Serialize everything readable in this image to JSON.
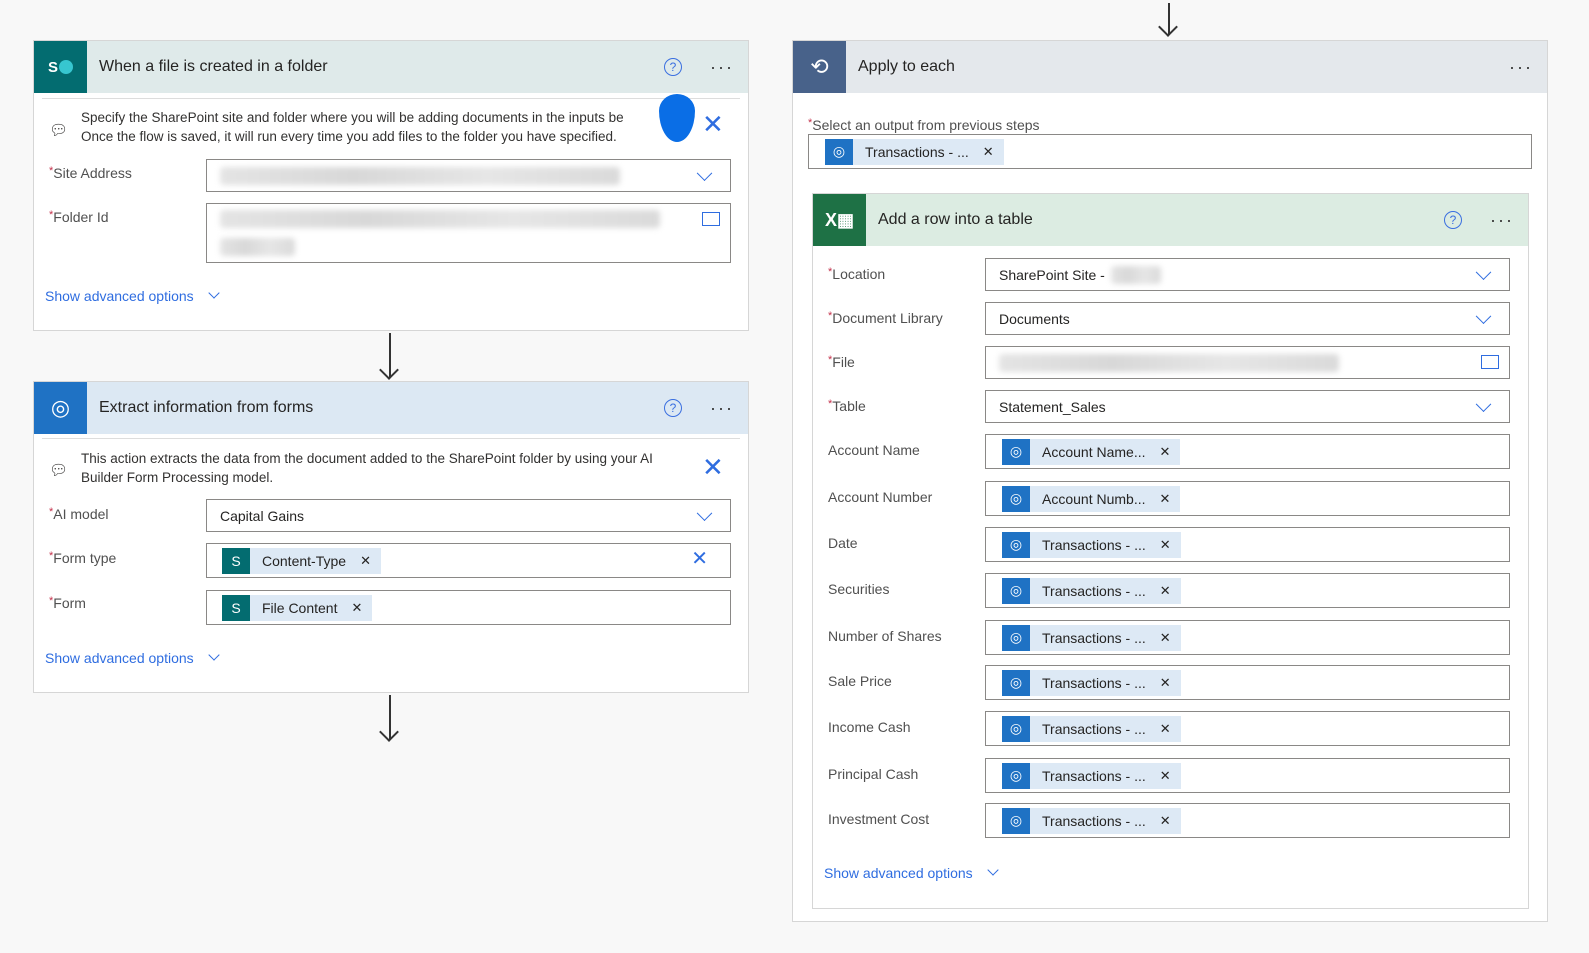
{
  "trigger": {
    "title": "When a file is created in a folder",
    "info": "Specify the SharePoint site and folder where you will be adding documents in the inputs below. Once the flow is saved, it will run every time you add files to the folder you have specified.",
    "info_line1": "Specify the SharePoint site and folder where you will be adding documents in the inputs be",
    "info_line2": "Once the flow is saved, it will run every time you add files to the folder you have specified.",
    "fields": [
      {
        "label": "Site Address"
      },
      {
        "label": "Folder Id"
      }
    ],
    "advanced": "Show advanced options"
  },
  "extract": {
    "title": "Extract information from forms",
    "info_line1": "This action extracts the data from the document added to the SharePoint folder by using your AI",
    "info_line2": "Builder Form Processing model.",
    "fields": [
      {
        "label": "AI model",
        "value": "Capital Gains"
      },
      {
        "label": "Form type",
        "chip": "Content-Type"
      },
      {
        "label": "Form",
        "chip": "File Content"
      }
    ],
    "advanced": "Show advanced options"
  },
  "loop": {
    "title": "Apply to each",
    "select_label": "Select an output from previous steps",
    "select_chip": "Transactions - ..."
  },
  "addrow": {
    "title": "Add a row into a table",
    "fields": [
      {
        "label": "Location",
        "value": "SharePoint Site -",
        "required": true
      },
      {
        "label": "Document Library",
        "value": "Documents",
        "required": true
      },
      {
        "label": "File",
        "value": "",
        "required": true
      },
      {
        "label": "Table",
        "value": "Statement_Sales",
        "required": true
      },
      {
        "label": "Account Name",
        "chip": "Account Name..."
      },
      {
        "label": "Account Number",
        "chip": "Account Numb..."
      },
      {
        "label": "Date",
        "chip": "Transactions - ..."
      },
      {
        "label": "Securities",
        "chip": "Transactions - ..."
      },
      {
        "label": "Number of Shares",
        "chip": "Transactions - ..."
      },
      {
        "label": "Sale Price",
        "chip": "Transactions - ..."
      },
      {
        "label": "Income Cash",
        "chip": "Transactions - ..."
      },
      {
        "label": "Principal Cash",
        "chip": "Transactions - ..."
      },
      {
        "label": "Investment Cost",
        "chip": "Transactions - ..."
      }
    ],
    "advanced": "Show advanced options"
  },
  "colors": {
    "sharepoint": "#036c70",
    "ai": "#1f72c4",
    "loop": "#48628a",
    "excel": "#1e7145"
  }
}
